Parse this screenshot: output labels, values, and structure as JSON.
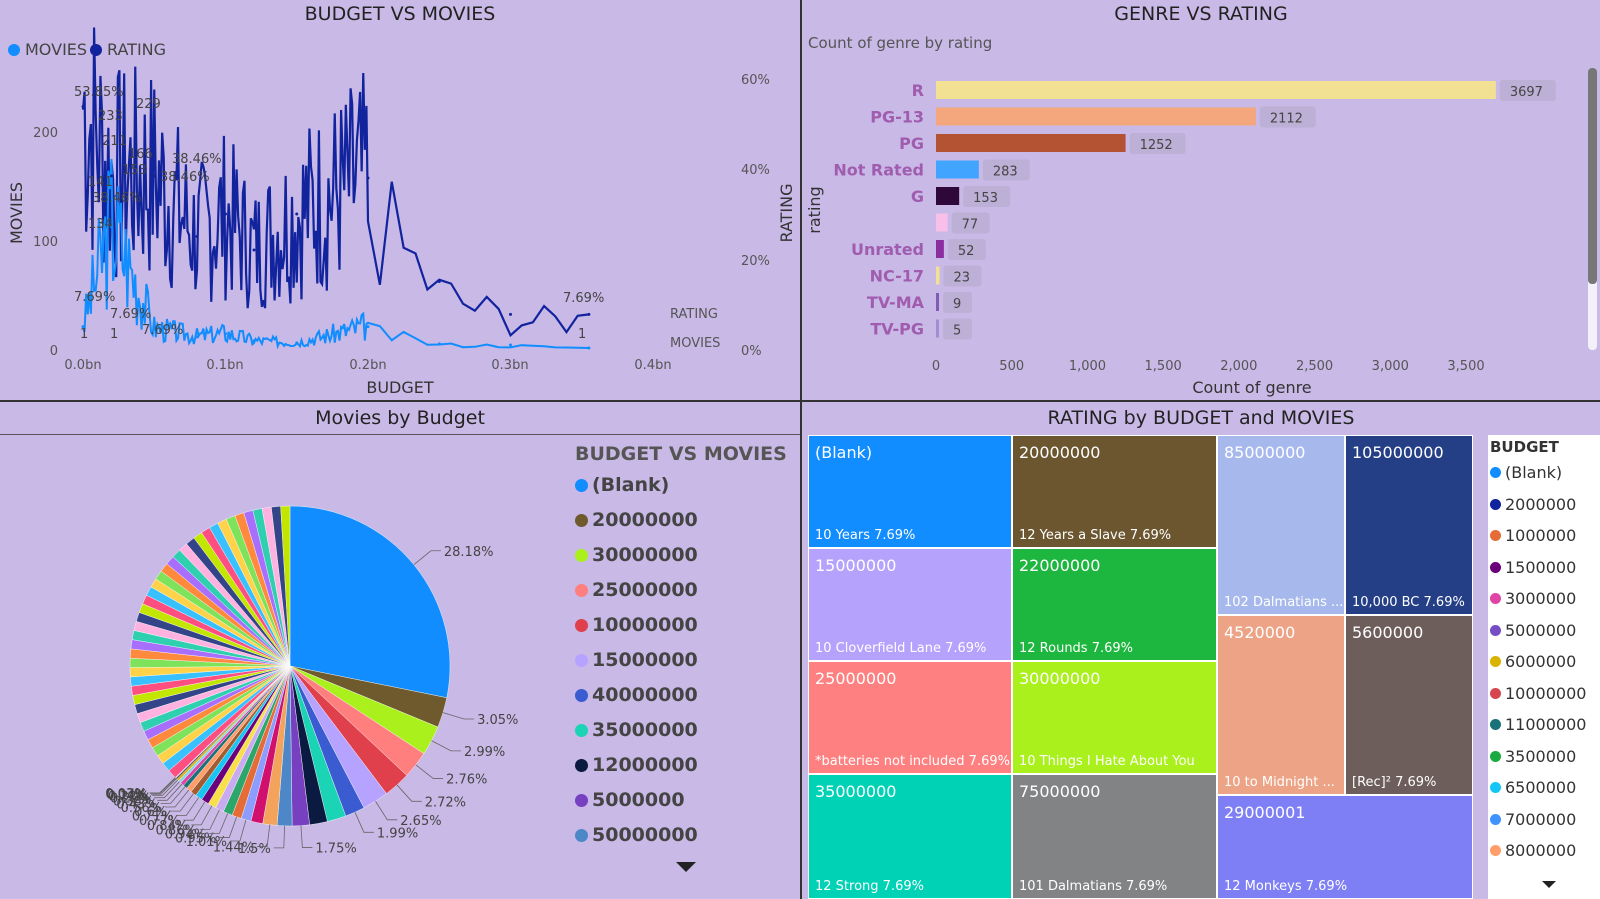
{
  "panels": {
    "budget_movies": {
      "title": "BUDGET VS MOVIES",
      "legend": [
        {
          "label": "MOVIES",
          "color": "#118DFF"
        },
        {
          "label": "RATING",
          "color": "#12239E"
        }
      ],
      "xlabel": "BUDGET",
      "ylabel_left": "MOVIES",
      "ylabel_right": "RATING",
      "x_ticks": [
        "0.0bn",
        "0.1bn",
        "0.2bn",
        "0.3bn",
        "0.4bn"
      ],
      "y_left_ticks": [
        "0",
        "100",
        "200"
      ],
      "y_right_ticks": [
        "0%",
        "20%",
        "40%",
        "60%"
      ],
      "series_end_labels": [
        "RATING",
        "MOVIES"
      ],
      "annotations": [
        "53.85%",
        "233",
        "229",
        "211",
        "166",
        "153",
        "141",
        "38.46%",
        "38.46%",
        "38.46%",
        "134",
        "7.69%",
        "7.69%",
        "7.69%",
        "7.69%",
        "1",
        "1",
        "1"
      ]
    },
    "genre_rating": {
      "title": "GENRE VS RATING",
      "subtitle": "Count of genre by rating",
      "xlabel": "Count of genre",
      "ylabel": "rating",
      "x_ticks": [
        "0",
        "500",
        "1,000",
        "1,500",
        "2,000",
        "2,500",
        "3,000",
        "3,500"
      ]
    },
    "pie": {
      "title": "Movies by Budget",
      "legend_title": "BUDGET VS MOVIES"
    },
    "treemap": {
      "title": "RATING by BUDGET and MOVIES",
      "legend_title": "BUDGET"
    }
  },
  "chart_data": [
    {
      "type": "line",
      "title": "BUDGET VS MOVIES",
      "xlabel": "BUDGET",
      "ylabel": "MOVIES",
      "xlim": [
        0,
        0.4
      ],
      "ylim_left": [
        0,
        260
      ],
      "ylim_right": [
        0,
        0.6
      ],
      "series": [
        {
          "name": "MOVIES",
          "color": "#118DFF",
          "x": [
            0.0,
            0.02,
            0.05,
            0.08,
            0.1,
            0.12,
            0.15,
            0.2,
            0.25,
            0.3,
            0.355
          ],
          "y": [
            22,
            120,
            20,
            12,
            15,
            8,
            6,
            22,
            5,
            4,
            1
          ]
        },
        {
          "name": "RATING",
          "color": "#12239E",
          "x": [
            0.0,
            0.02,
            0.05,
            0.08,
            0.1,
            0.12,
            0.15,
            0.2,
            0.25,
            0.3,
            0.355
          ],
          "y": [
            0.5385,
            0.3846,
            0.3846,
            0.25,
            0.3,
            0.22,
            0.3,
            0.38,
            0.15,
            0.0769,
            0.0769
          ]
        }
      ]
    },
    {
      "type": "bar",
      "title": "GENRE VS RATING",
      "xlabel": "Count of genre",
      "ylabel": "rating",
      "xlim": [
        0,
        3800
      ],
      "categories": [
        "R",
        "PG-13",
        "PG",
        "Not Rated",
        "G",
        "",
        "Unrated",
        "NC-17",
        "TV-MA",
        "TV-PG"
      ],
      "values": [
        3697,
        2112,
        1252,
        283,
        153,
        77,
        52,
        23,
        9,
        5
      ],
      "colors": [
        "#F3E193",
        "#F4A67D",
        "#B35333",
        "#41A4FF",
        "#2E0838",
        "#F8BFE8",
        "#8B2FA0",
        "#F3E193",
        "#7F5DB3",
        "#9E8FD0"
      ]
    },
    {
      "type": "pie",
      "title": "Movies by Budget",
      "legend": [
        {
          "label": "(Blank)",
          "color": "#118DFF"
        },
        {
          "label": "20000000",
          "color": "#6E5A2C"
        },
        {
          "label": "30000000",
          "color": "#A9F01D"
        },
        {
          "label": "25000000",
          "color": "#FF7F7F"
        },
        {
          "label": "10000000",
          "color": "#E0404C"
        },
        {
          "label": "15000000",
          "color": "#B6A2FF"
        },
        {
          "label": "40000000",
          "color": "#3B5BD0"
        },
        {
          "label": "35000000",
          "color": "#1BD3B5"
        },
        {
          "label": "12000000",
          "color": "#0B1A40"
        },
        {
          "label": "5000000",
          "color": "#7740C0"
        },
        {
          "label": "50000000",
          "color": "#4E87C7"
        }
      ],
      "slices": [
        {
          "label": "28.18%",
          "value": 28.18
        },
        {
          "label": "3.05%",
          "value": 3.05
        },
        {
          "label": "2.99%",
          "value": 2.99
        },
        {
          "label": "2.76%",
          "value": 2.76
        },
        {
          "label": "2.72%",
          "value": 2.72
        },
        {
          "label": "2.65%",
          "value": 2.65
        },
        {
          "label": "1.99%",
          "value": 1.99
        },
        {
          "label": "",
          "value": 1.9
        },
        {
          "label": "",
          "value": 1.8
        },
        {
          "label": "1.75%",
          "value": 1.75
        },
        {
          "label": "1.5%",
          "value": 1.5
        },
        {
          "label": "1.44%",
          "value": 1.44
        },
        {
          "label": "",
          "value": 1.2
        },
        {
          "label": "1.01%",
          "value": 1.01
        },
        {
          "label": "0.95%",
          "value": 0.95
        },
        {
          "label": "0.94%",
          "value": 0.94
        },
        {
          "label": "0.86%",
          "value": 0.86
        },
        {
          "label": "0.84%",
          "value": 0.84
        },
        {
          "label": "0.77%",
          "value": 0.77
        },
        {
          "label": "0.71%",
          "value": 0.71
        },
        {
          "label": "0.6%",
          "value": 0.6
        },
        {
          "label": "0.56%",
          "value": 0.56
        },
        {
          "label": "0.43%",
          "value": 0.43
        },
        {
          "label": "0.38%",
          "value": 0.38
        },
        {
          "label": "0.29%",
          "value": 0.29
        },
        {
          "label": "0.22%",
          "value": 0.22
        },
        {
          "label": "0.14%",
          "value": 0.14
        },
        {
          "label": "0.07%",
          "value": 0.07
        },
        {
          "label": "0.03%",
          "value": 0.03
        }
      ]
    },
    {
      "type": "treemap",
      "title": "RATING by BUDGET and MOVIES",
      "tiles": [
        {
          "budget": "(Blank)",
          "movie": "10 Years 7.69%",
          "color": "#118DFF"
        },
        {
          "budget": "20000000",
          "movie": "12 Years a Slave 7.69%",
          "color": "#6B5630"
        },
        {
          "budget": "85000000",
          "movie": "102 Dalmatians ...",
          "color": "#A7B9EC"
        },
        {
          "budget": "105000000",
          "movie": "10,000 BC 7.69%",
          "color": "#253F87"
        },
        {
          "budget": "15000000",
          "movie": "10 Cloverfield Lane 7.69%",
          "color": "#B4A2FD"
        },
        {
          "budget": "22000000",
          "movie": "12 Rounds 7.69%",
          "color": "#1DB63E"
        },
        {
          "budget": "4520000",
          "movie": "10 to Midnight ...",
          "color": "#EDA386"
        },
        {
          "budget": "5600000",
          "movie": "[Rec]² 7.69%",
          "color": "#6E5E5B"
        },
        {
          "budget": "25000000",
          "movie": "*batteries not included 7.69%",
          "color": "#FF8080"
        },
        {
          "budget": "30000000",
          "movie": "10 Things I Hate About You",
          "color": "#A9F01C"
        },
        {
          "budget": "29000001",
          "movie": "12 Monkeys 7.69%",
          "color": "#7E7FF5"
        },
        {
          "budget": "35000000",
          "movie": "12 Strong 7.69%",
          "color": "#00D2B6"
        },
        {
          "budget": "75000000",
          "movie": "101 Dalmatians 7.69%",
          "color": "#828385"
        }
      ],
      "legend": [
        {
          "label": "(Blank)",
          "color": "#118DFF"
        },
        {
          "label": "2000000",
          "color": "#12239E"
        },
        {
          "label": "1000000",
          "color": "#E66C37"
        },
        {
          "label": "1500000",
          "color": "#6B007B"
        },
        {
          "label": "3000000",
          "color": "#E044A7"
        },
        {
          "label": "5000000",
          "color": "#744EC2"
        },
        {
          "label": "6000000",
          "color": "#D9B300"
        },
        {
          "label": "10000000",
          "color": "#D64550"
        },
        {
          "label": "11000000",
          "color": "#197278"
        },
        {
          "label": "3500000",
          "color": "#1AAB40"
        },
        {
          "label": "6500000",
          "color": "#15C6F4"
        },
        {
          "label": "7000000",
          "color": "#4092FF"
        },
        {
          "label": "8000000",
          "color": "#FF9E6B"
        }
      ]
    }
  ]
}
